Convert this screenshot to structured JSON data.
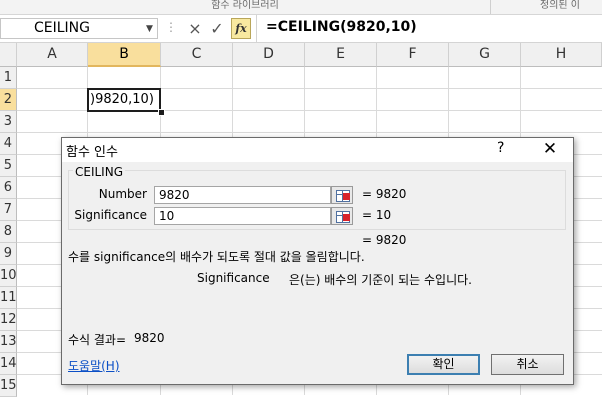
{
  "ribbon": {
    "groups": [
      "함수 라이브러리",
      "정의된 이"
    ]
  },
  "formula_bar": {
    "name_box": "CEILING",
    "cancel_icon": "×",
    "enter_icon": "✓",
    "fx_label": "fx",
    "formula": "=CEILING(9820,10)"
  },
  "grid": {
    "columns": [
      "A",
      "B",
      "C",
      "D",
      "E",
      "F",
      "G",
      "H"
    ],
    "selected_column": "B",
    "rows": [
      "1",
      "2",
      "3",
      "4",
      "5",
      "6",
      "7",
      "8",
      "9",
      "10",
      "11",
      "12",
      "13",
      "14",
      "15"
    ],
    "selected_row": "2",
    "active_cell_text": ")9820,10)"
  },
  "dialog": {
    "title": "함수 인수",
    "help_glyph": "?",
    "close_glyph": "✕",
    "function_name": "CEILING",
    "args": [
      {
        "label": "Number",
        "value": "9820",
        "result": "= 9820"
      },
      {
        "label": "Significance",
        "value": "10",
        "result": "= 10"
      }
    ],
    "total_result": "= 9820",
    "description": "수를 significance의 배수가 되도록 절대 값을 올림합니다.",
    "arg_desc_name": "Significance",
    "arg_desc_text": "은(는) 배수의 기준이 되는 수입니다.",
    "formula_result_label": "수식 결과=",
    "formula_result_value": "9820",
    "help_link": "도움말(H)",
    "ok_label": "확인",
    "cancel_label": "취소"
  }
}
